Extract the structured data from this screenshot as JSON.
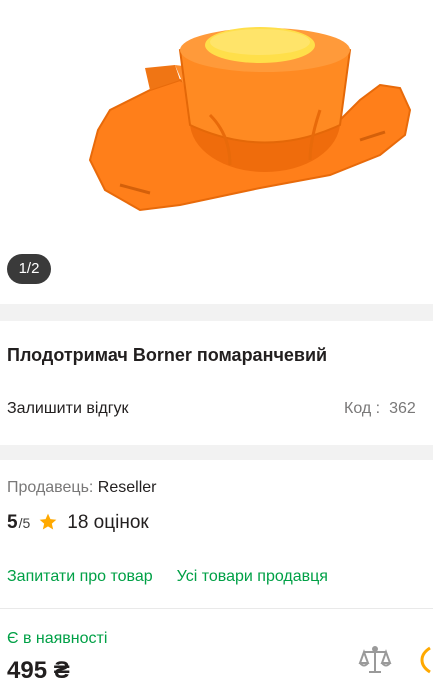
{
  "gallery": {
    "counter": "1/2",
    "image_icon": "slicer-hand-guard-image"
  },
  "product": {
    "title": "Плодотримач Borner помаранчевий",
    "review_link": "Залишити відгук",
    "code_label": "Код :",
    "code_value": "362"
  },
  "seller": {
    "label": "Продавець:",
    "name": "Reseller",
    "rating": "5",
    "rating_of": "/5",
    "reviews": "18 оцінок",
    "ask_link": "Запитати про товар",
    "all_products_link": "Усі товари продавця"
  },
  "purchase": {
    "stock_status": "Є в наявності",
    "price": "495 ₴",
    "compare_icon": "scales-compare-icon"
  },
  "colors": {
    "accent_green": "#00a046",
    "star": "#ffa900",
    "product_orange": "#ff7f1a",
    "product_yellow": "#ffdf4a"
  }
}
